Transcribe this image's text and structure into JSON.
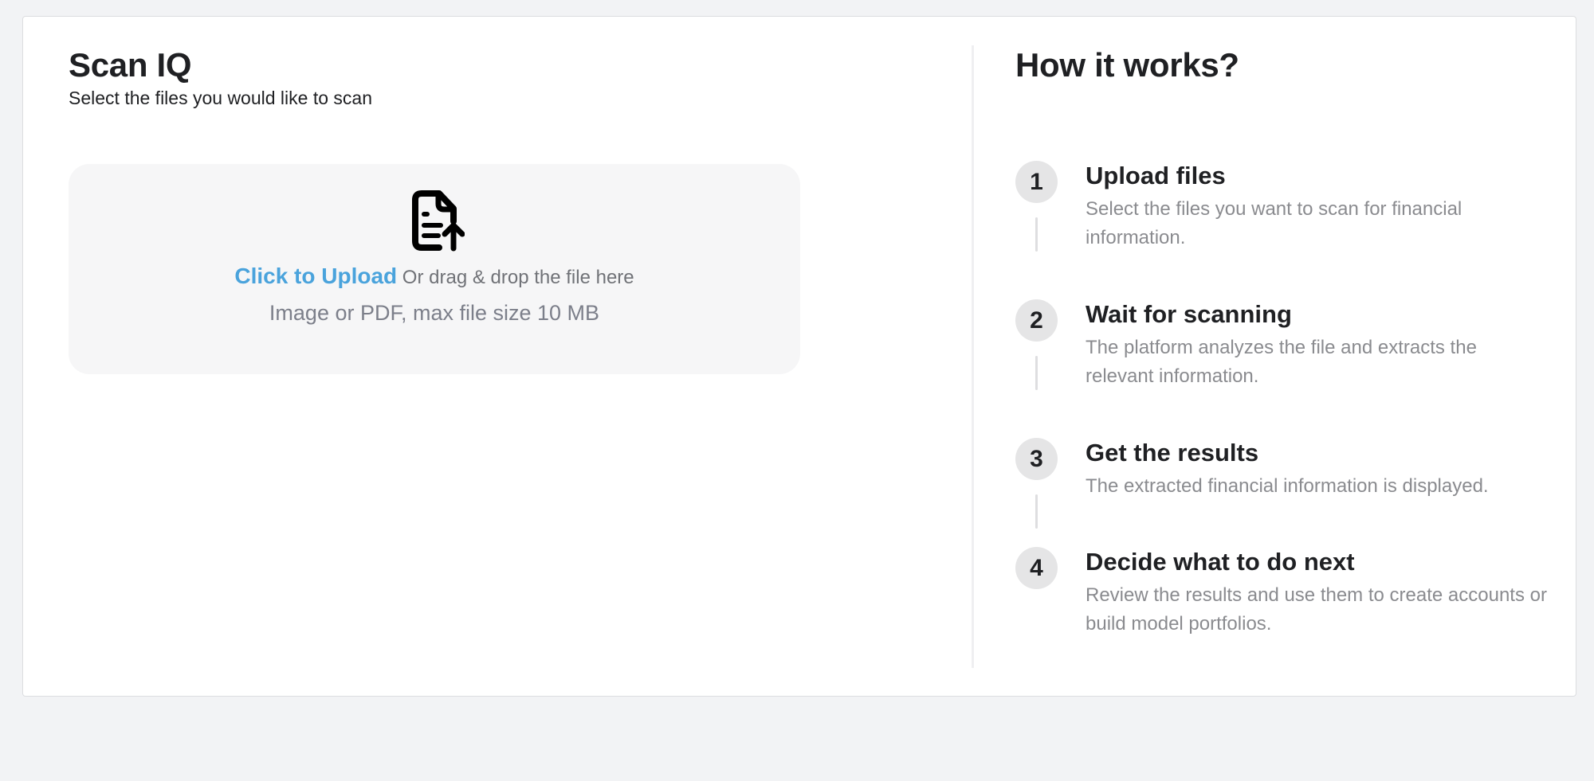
{
  "scan": {
    "title": "Scan IQ",
    "subtitle": "Select the files you would like to scan",
    "dropzone": {
      "icon": "file-upload-icon",
      "link_label": "Click to Upload",
      "drag_text": " Or drag & drop the file here",
      "hint": "Image or PDF, max file size 10 MB"
    }
  },
  "how": {
    "title": "How it works?",
    "steps": [
      {
        "number": "1",
        "title": "Upload files",
        "description": "Select the files you want to scan for financial information."
      },
      {
        "number": "2",
        "title": "Wait for scanning",
        "description": "The platform analyzes the file and extracts the relevant information."
      },
      {
        "number": "3",
        "title": "Get the results",
        "description": "The extracted financial information is displayed."
      },
      {
        "number": "4",
        "title": "Decide what to do next",
        "description": "Review the results and use them to create accounts or build model portfolios."
      }
    ]
  },
  "colors": {
    "accent": "#4aa3dc",
    "text": "#1f2023",
    "muted": "#8a8b8f",
    "page_bg": "#f2f3f5"
  }
}
